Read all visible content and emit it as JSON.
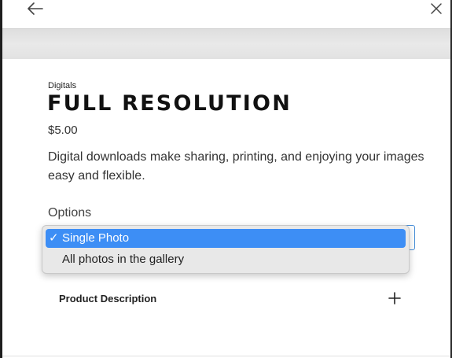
{
  "header": {
    "back_icon": "arrow-left-icon",
    "close_icon": "close-icon"
  },
  "product": {
    "category": "Digitals",
    "title": "FULL RESOLUTION",
    "price": "$5.00",
    "description": "Digital downloads make sharing, printing, and enjoying your images easy and flexible."
  },
  "options": {
    "label": "Options",
    "selected_value": "Single Photo",
    "items": [
      {
        "label": "Single Photo",
        "checkmark": "✓",
        "selected": true
      },
      {
        "label": "All photos in the gallery",
        "checkmark": "",
        "selected": false
      }
    ],
    "highlight_color": "#3d8ef5"
  },
  "details": {
    "product_description_label": "Product Description",
    "expand_icon": "plus-icon"
  }
}
